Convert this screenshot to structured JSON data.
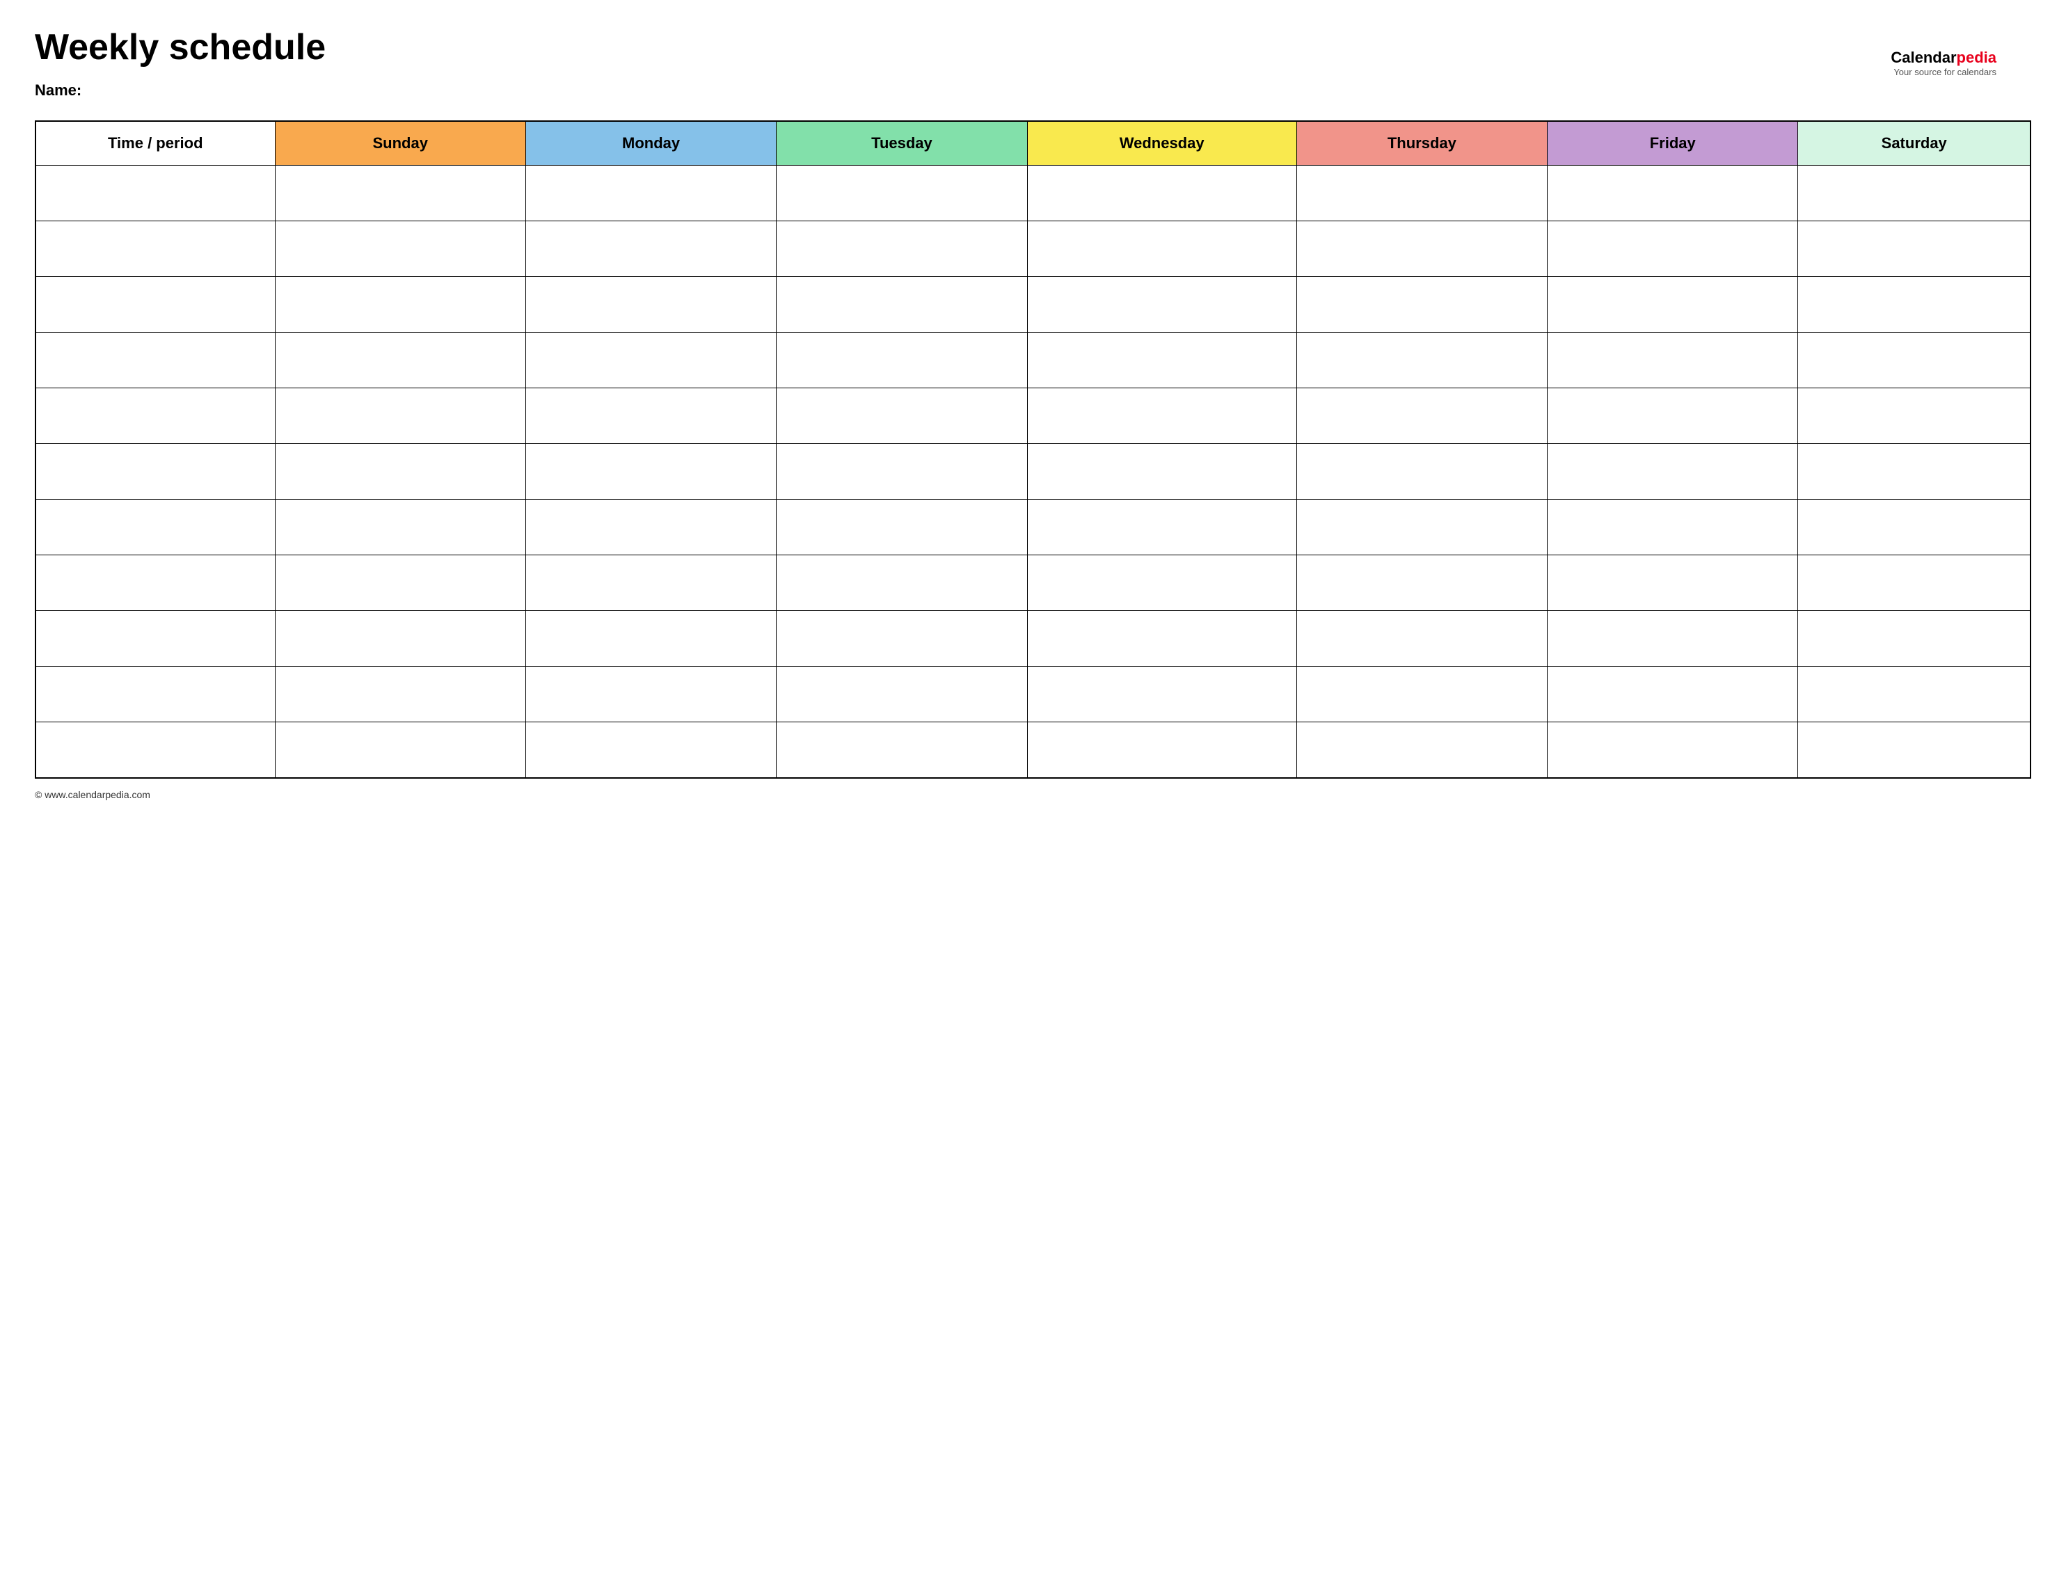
{
  "page": {
    "title": "Weekly schedule",
    "name_label": "Name:",
    "footer_url": "© www.calendarpedia.com"
  },
  "logo": {
    "brand_part1": "Calendar",
    "brand_part2": "pedia",
    "tagline": "Your source for calendars"
  },
  "table": {
    "headers": {
      "time_period": "Time / period",
      "sunday": "Sunday",
      "monday": "Monday",
      "tuesday": "Tuesday",
      "wednesday": "Wednesday",
      "thursday": "Thursday",
      "friday": "Friday",
      "saturday": "Saturday"
    },
    "row_count": 11
  }
}
